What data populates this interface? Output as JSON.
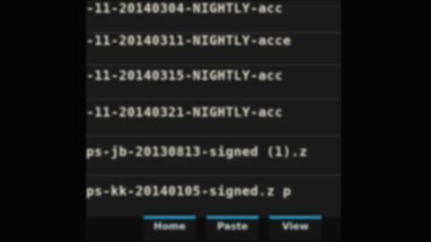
{
  "files": [
    "-11-20140304-NIGHTLY-acc",
    "-11-20140311-NIGHTLY-acce",
    "-11-20140315-NIGHTLY-acc",
    "-11-20140321-NIGHTLY-acc",
    "ps-jb-20130813-signed (1).z",
    "ps-kk-20140105-signed.z p"
  ],
  "bottom_bar": {
    "buttons": [
      "Home",
      "Paste",
      "View"
    ]
  },
  "colors": {
    "accent": "#27a4d6",
    "text": "#e9e3d4",
    "background": "#1a1a1a"
  }
}
